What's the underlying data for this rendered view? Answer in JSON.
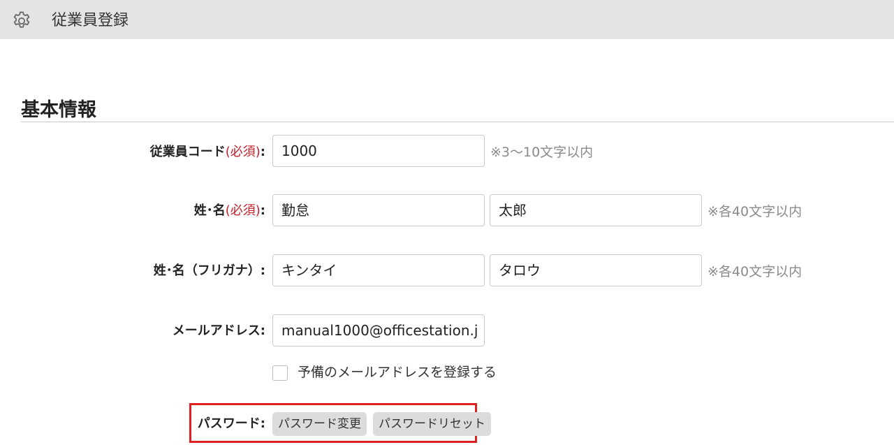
{
  "header": {
    "icon": "gear-icon",
    "title": "従業員登録"
  },
  "section": {
    "title": "基本情報"
  },
  "form": {
    "employee_code": {
      "label": "従業員コード",
      "required": "(必須)",
      "colon": ":",
      "value": "1000",
      "hint": "※3～10文字以内"
    },
    "name": {
      "label": "姓･名",
      "required": "(必須)",
      "colon": ":",
      "last_value": "勤怠",
      "first_value": "太郎",
      "hint": "※各40文字以内"
    },
    "kana": {
      "label": "姓･名（フリガナ）:",
      "last_value": "キンタイ",
      "first_value": "タロウ",
      "hint": "※各40文字以内"
    },
    "email": {
      "label": "メールアドレス:",
      "value": "manual1000@officestation.j"
    },
    "backup_email": {
      "checked": false,
      "label": "予備のメールアドレスを登録する"
    },
    "password": {
      "label": "パスワード:",
      "change_button": "パスワード変更",
      "reset_button": "パスワードリセット"
    }
  },
  "colors": {
    "topbar_bg": "#e4e4e4",
    "required_red": "#c8202a",
    "highlight_red": "#e02020",
    "button_bg": "#dcdcdc"
  }
}
